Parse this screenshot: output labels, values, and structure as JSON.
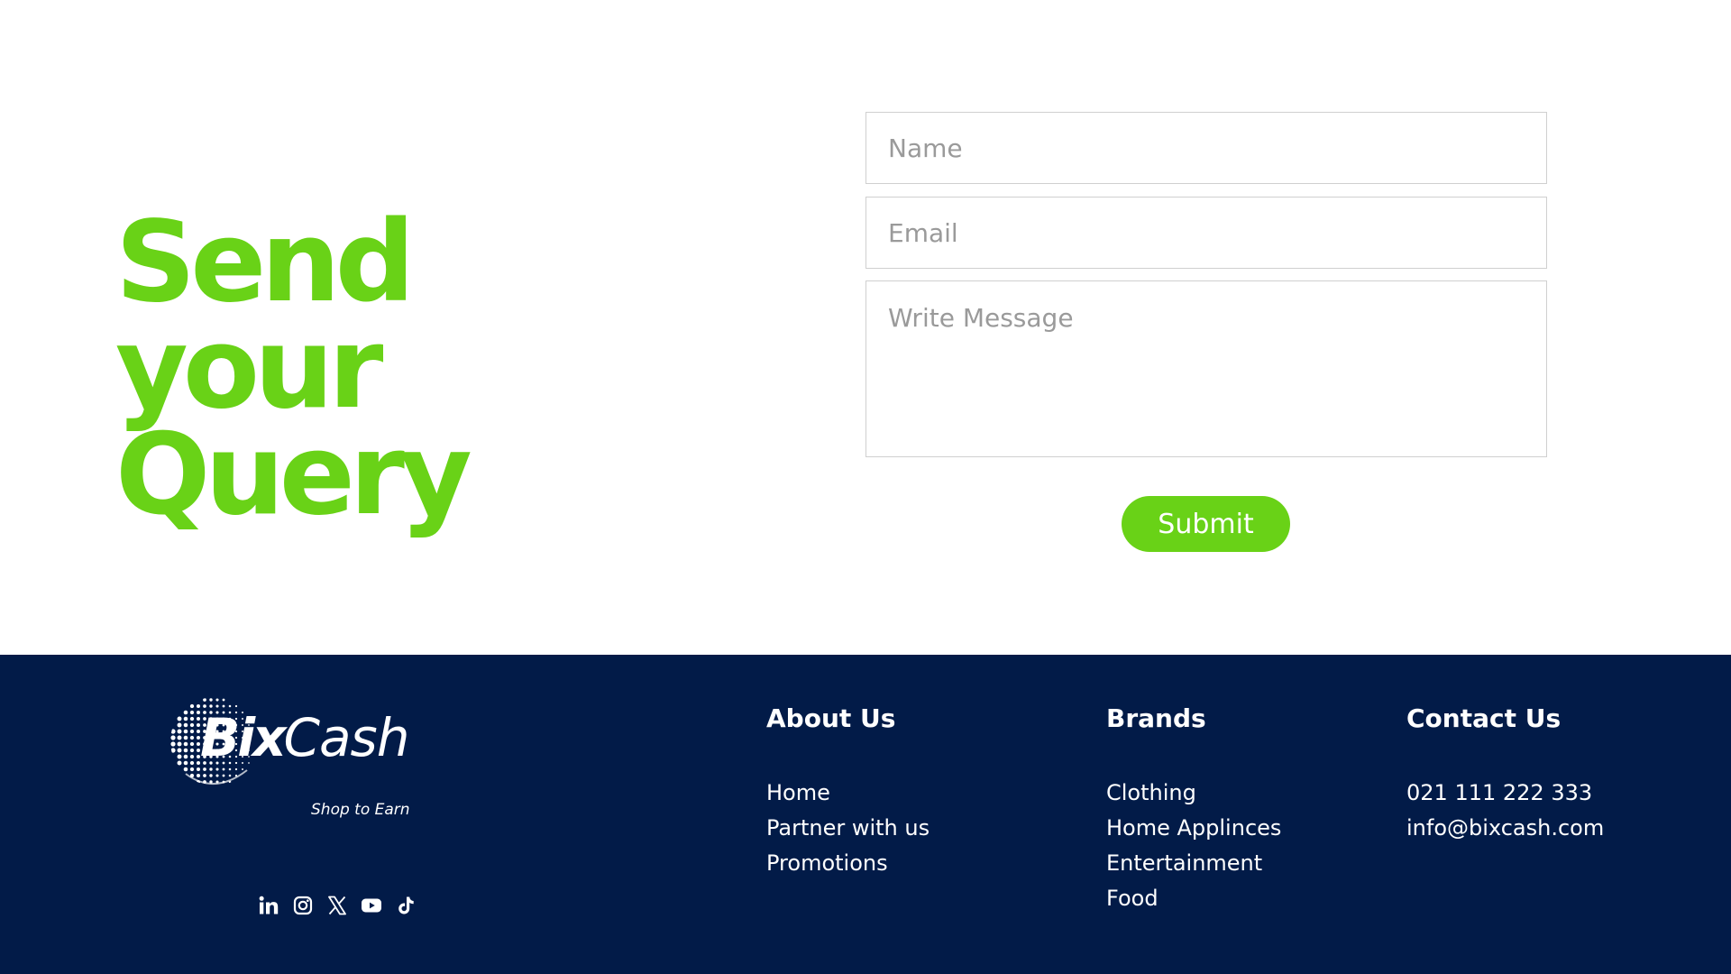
{
  "query": {
    "title_line1": "Send your",
    "title_line2": "Query",
    "name_placeholder": "Name",
    "email_placeholder": "Email",
    "message_placeholder": "Write Message",
    "submit_label": "Submit"
  },
  "footer": {
    "logo": {
      "word_bold": "Bix",
      "word_light": "Cash",
      "tagline": "Shop to Earn"
    },
    "social_icons": [
      "linkedin-icon",
      "instagram-icon",
      "x-icon",
      "youtube-icon",
      "tiktok-icon"
    ],
    "about": {
      "title": "About Us",
      "links": [
        "Home",
        "Partner with us",
        "Promotions"
      ]
    },
    "brands": {
      "title": "Brands",
      "links": [
        "Clothing",
        "Home Applinces",
        "Entertainment",
        "Food"
      ]
    },
    "contact": {
      "title": "Contact Us",
      "phone": "021 111 222 333",
      "email": "info@bixcash.com"
    }
  },
  "colors": {
    "accent_green": "#69d217",
    "footer_navy": "#021b48",
    "field_border": "#d0d0d0"
  }
}
